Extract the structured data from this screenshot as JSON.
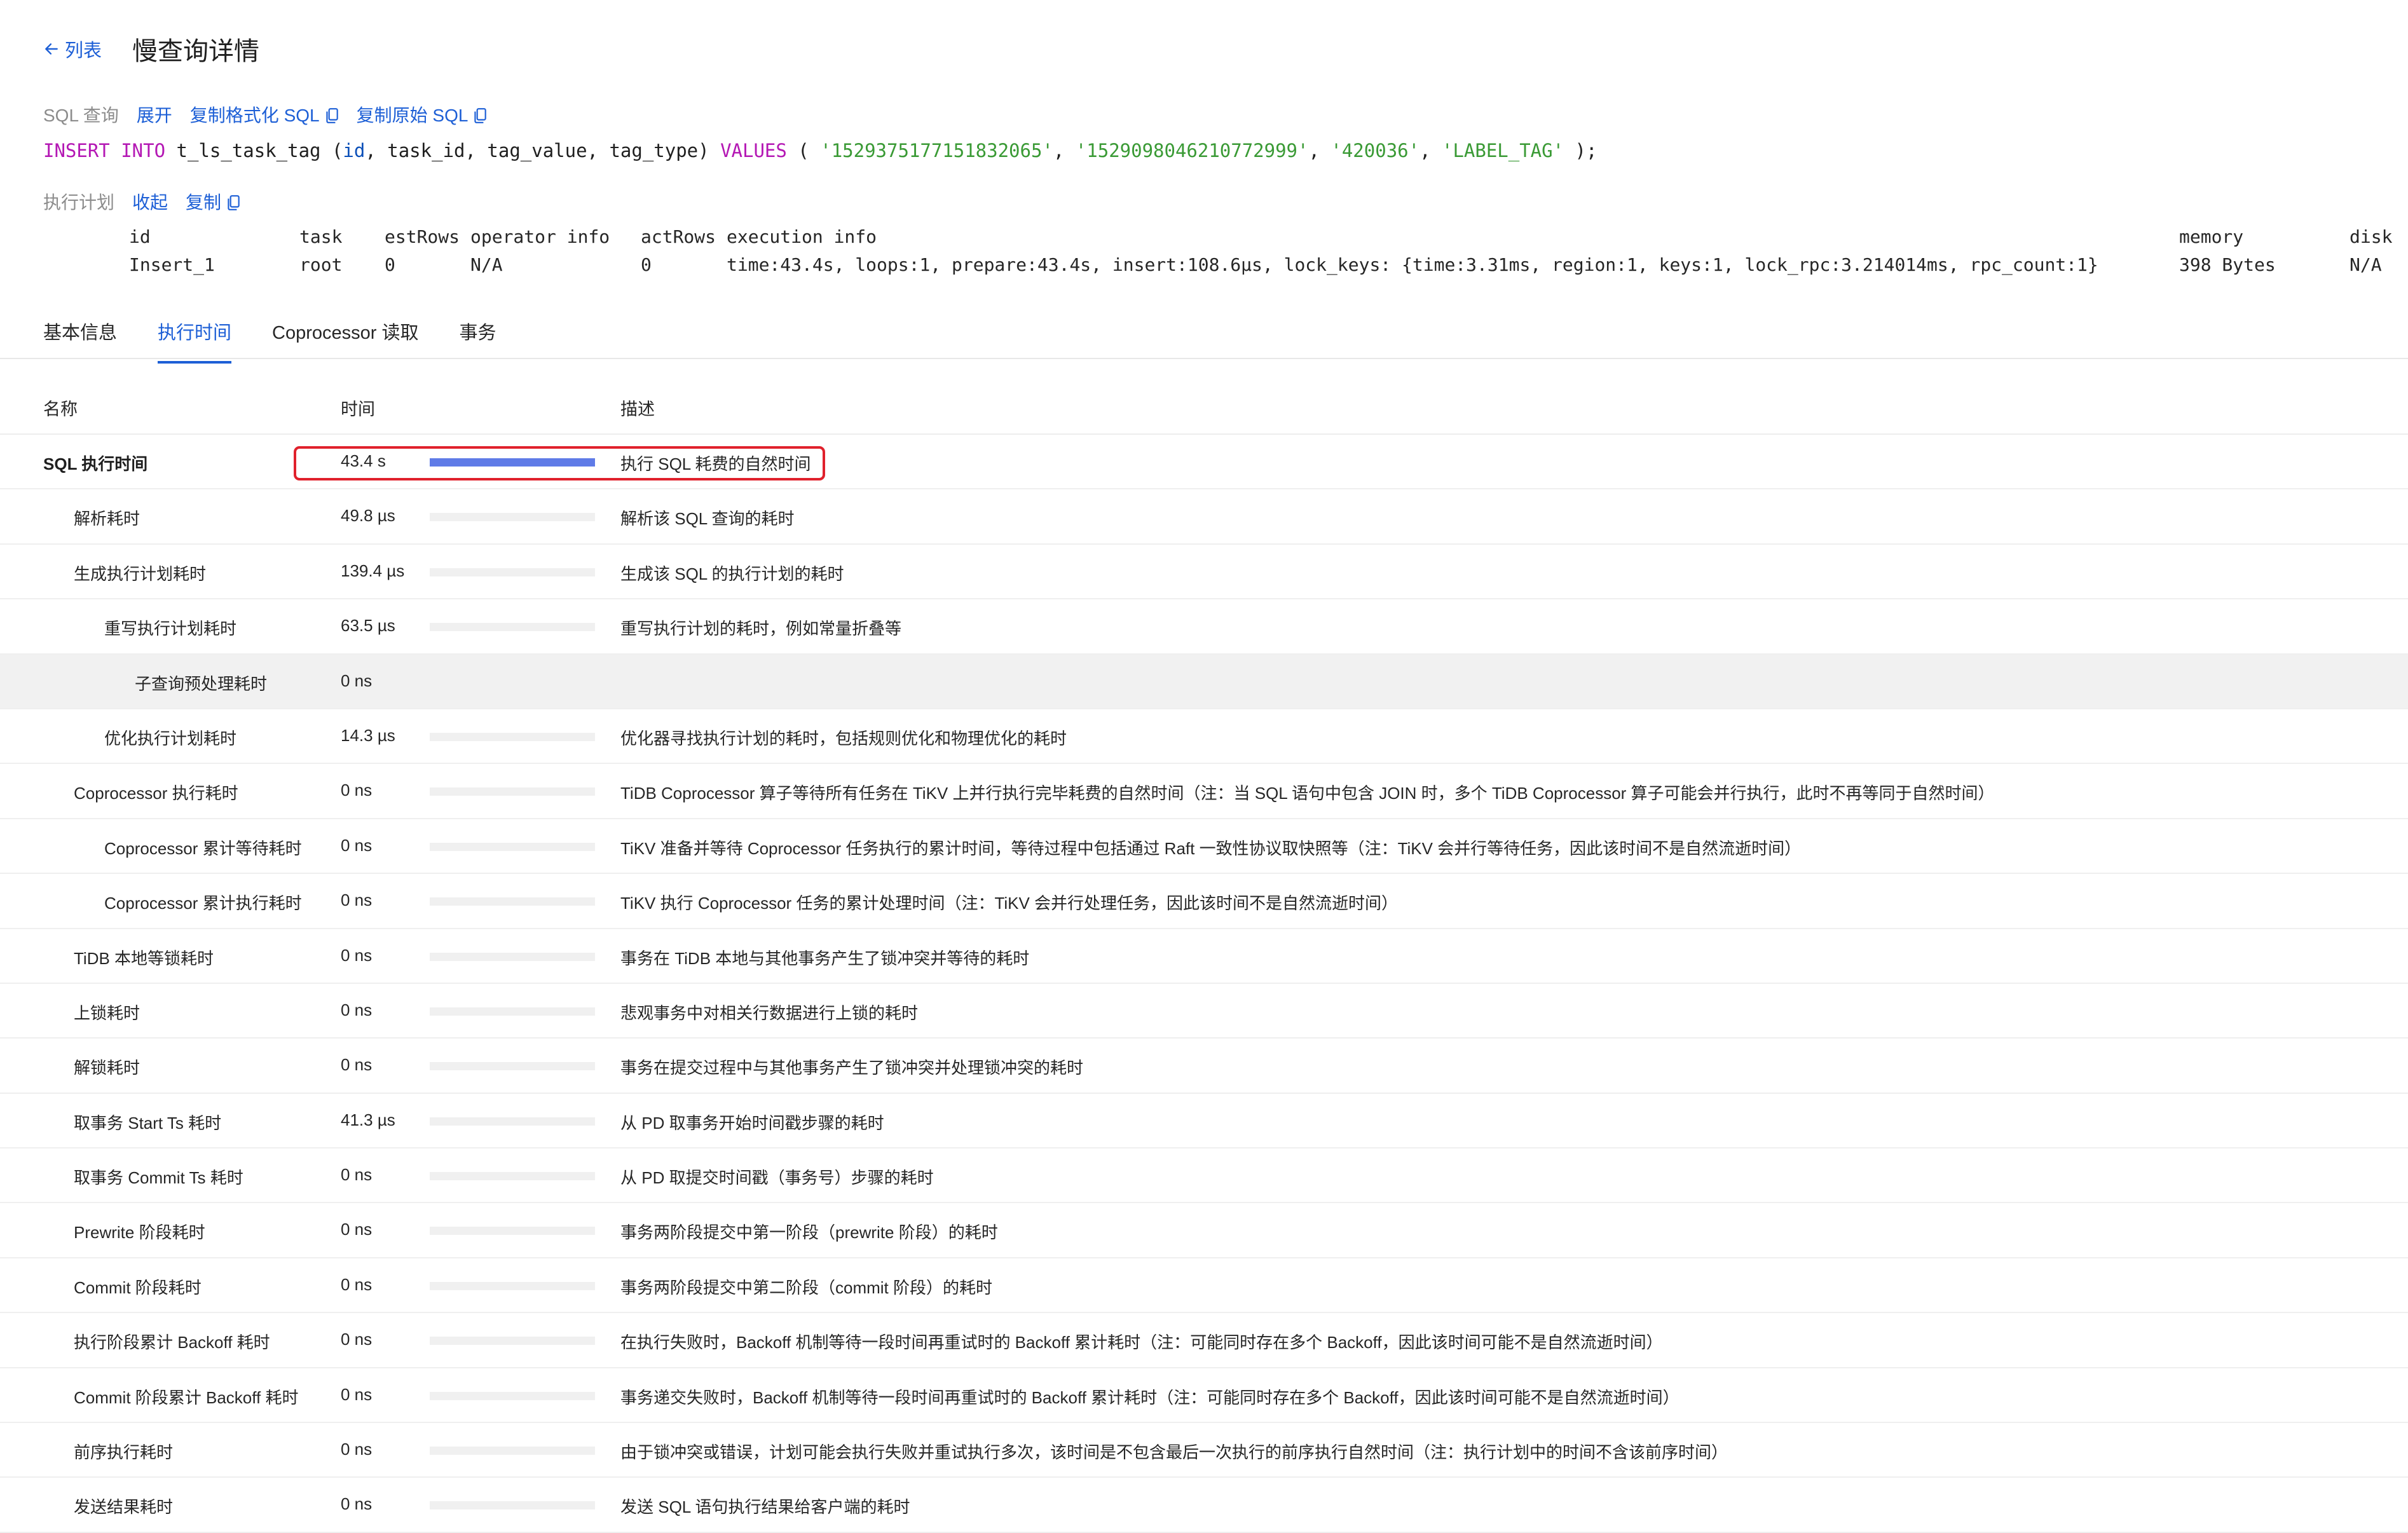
{
  "header": {
    "back_label": "列表",
    "title": "慢查询详情"
  },
  "sql": {
    "label": "SQL 查询",
    "expand": "展开",
    "copy_formatted": "复制格式化 SQL",
    "copy_original": "复制原始 SQL",
    "kw1": "INSERT INTO",
    "table": " t_ls_task_tag (",
    "c1": "id",
    "c2": "task_id",
    "c3": "tag_value",
    "c4": "tag_type",
    "close_paren": ") ",
    "kw2": "VALUES",
    "open_paren": " ( ",
    "v1": "'1529375177151832065'",
    "v2": "'1529098046210772999'",
    "v3": "'420036'",
    "v4": "'LABEL_TAG'",
    "end": " );",
    "sep": ", "
  },
  "plan": {
    "label": "执行计划",
    "collapse": "收起",
    "copy": "复制",
    "headers": [
      "id",
      "task",
      "estRows",
      "operator info",
      "actRows",
      "execution info",
      "memory",
      "disk"
    ],
    "row": [
      "Insert_1",
      "root",
      "0",
      "N/A",
      "0",
      "time:43.4s, loops:1, prepare:43.4s, insert:108.6µs, lock_keys: {time:3.31ms, region:1, keys:1, lock_rpc:3.214014ms, rpc_count:1}",
      "398 Bytes",
      "N/A"
    ]
  },
  "tabs": [
    "基本信息",
    "执行时间",
    "Coprocessor 读取",
    "事务"
  ],
  "active_tab": 1,
  "table": {
    "headers": {
      "name": "名称",
      "time": "时间",
      "desc": "描述"
    },
    "rows": [
      {
        "name": "SQL 执行时间",
        "time": "43.4 s",
        "desc": "执行 SQL 耗费的自然时间",
        "fill": 1.0,
        "level": 0,
        "bold": true
      },
      {
        "name": "解析耗时",
        "time": "49.8 µs",
        "desc": "解析该 SQL 查询的耗时",
        "fill": 0,
        "level": 1
      },
      {
        "name": "生成执行计划耗时",
        "time": "139.4 µs",
        "desc": "生成该 SQL 的执行计划的耗时",
        "fill": 0,
        "level": 1
      },
      {
        "name": "重写执行计划耗时",
        "time": "63.5 µs",
        "desc": "重写执行计划的耗时，例如常量折叠等",
        "fill": 0,
        "level": 2
      },
      {
        "name": "子查询预处理耗时",
        "time": "0 ns",
        "desc": "",
        "fill": 0,
        "level": 3,
        "highlight": true,
        "no_bar": true
      },
      {
        "name": "优化执行计划耗时",
        "time": "14.3 µs",
        "desc": "优化器寻找执行计划的耗时，包括规则优化和物理优化的耗时",
        "fill": 0,
        "level": 2
      },
      {
        "name": "Coprocessor 执行耗时",
        "time": "0 ns",
        "desc": "TiDB Coprocessor 算子等待所有任务在 TiKV 上并行执行完毕耗费的自然时间（注：当 SQL 语句中包含 JOIN 时，多个 TiDB Coprocessor 算子可能会并行执行，此时不再等同于自然时间）",
        "fill": 0,
        "level": 1
      },
      {
        "name": "Coprocessor 累计等待耗时",
        "time": "0 ns",
        "desc": "TiKV 准备并等待 Coprocessor 任务执行的累计时间，等待过程中包括通过 Raft 一致性协议取快照等（注：TiKV 会并行等待任务，因此该时间不是自然流逝时间）",
        "fill": 0,
        "level": 2
      },
      {
        "name": "Coprocessor 累计执行耗时",
        "time": "0 ns",
        "desc": "TiKV 执行 Coprocessor 任务的累计处理时间（注：TiKV 会并行处理任务，因此该时间不是自然流逝时间）",
        "fill": 0,
        "level": 2
      },
      {
        "name": "TiDB 本地等锁耗时",
        "time": "0 ns",
        "desc": "事务在 TiDB 本地与其他事务产生了锁冲突并等待的耗时",
        "fill": 0,
        "level": 1
      },
      {
        "name": "上锁耗时",
        "time": "0 ns",
        "desc": "悲观事务中对相关行数据进行上锁的耗时",
        "fill": 0,
        "level": 1
      },
      {
        "name": "解锁耗时",
        "time": "0 ns",
        "desc": "事务在提交过程中与其他事务产生了锁冲突并处理锁冲突的耗时",
        "fill": 0,
        "level": 1
      },
      {
        "name": "取事务 Start Ts 耗时",
        "time": "41.3 µs",
        "desc": "从 PD 取事务开始时间戳步骤的耗时",
        "fill": 0,
        "level": 1
      },
      {
        "name": "取事务 Commit Ts 耗时",
        "time": "0 ns",
        "desc": "从 PD 取提交时间戳（事务号）步骤的耗时",
        "fill": 0,
        "level": 1
      },
      {
        "name": "Prewrite 阶段耗时",
        "time": "0 ns",
        "desc": "事务两阶段提交中第一阶段（prewrite 阶段）的耗时",
        "fill": 0,
        "level": 1
      },
      {
        "name": "Commit 阶段耗时",
        "time": "0 ns",
        "desc": "事务两阶段提交中第二阶段（commit 阶段）的耗时",
        "fill": 0,
        "level": 1
      },
      {
        "name": "执行阶段累计 Backoff 耗时",
        "time": "0 ns",
        "desc": "在执行失败时，Backoff 机制等待一段时间再重试时的 Backoff 累计耗时（注：可能同时存在多个 Backoff，因此该时间可能不是自然流逝时间）",
        "fill": 0,
        "level": 1
      },
      {
        "name": "Commit 阶段累计 Backoff 耗时",
        "time": "0 ns",
        "desc": "事务递交失败时，Backoff 机制等待一段时间再重试时的 Backoff 累计耗时（注：可能同时存在多个 Backoff，因此该时间可能不是自然流逝时间）",
        "fill": 0,
        "level": 1
      },
      {
        "name": "前序执行耗时",
        "time": "0 ns",
        "desc": "由于锁冲突或错误，计划可能会执行失败并重试执行多次，该时间是不包含最后一次执行的前序执行自然时间（注：执行计划中的时间不含该前序时间）",
        "fill": 0,
        "level": 1
      },
      {
        "name": "发送结果耗时",
        "time": "0 ns",
        "desc": "发送 SQL 语句执行结果给客户端的耗时",
        "fill": 0,
        "level": 1
      }
    ]
  },
  "colors": {
    "accent": "#1d5fd6",
    "bar_fill": "#5f7be7",
    "bar_track": "#f0f0f0",
    "highlight_box": "#e0212c"
  }
}
